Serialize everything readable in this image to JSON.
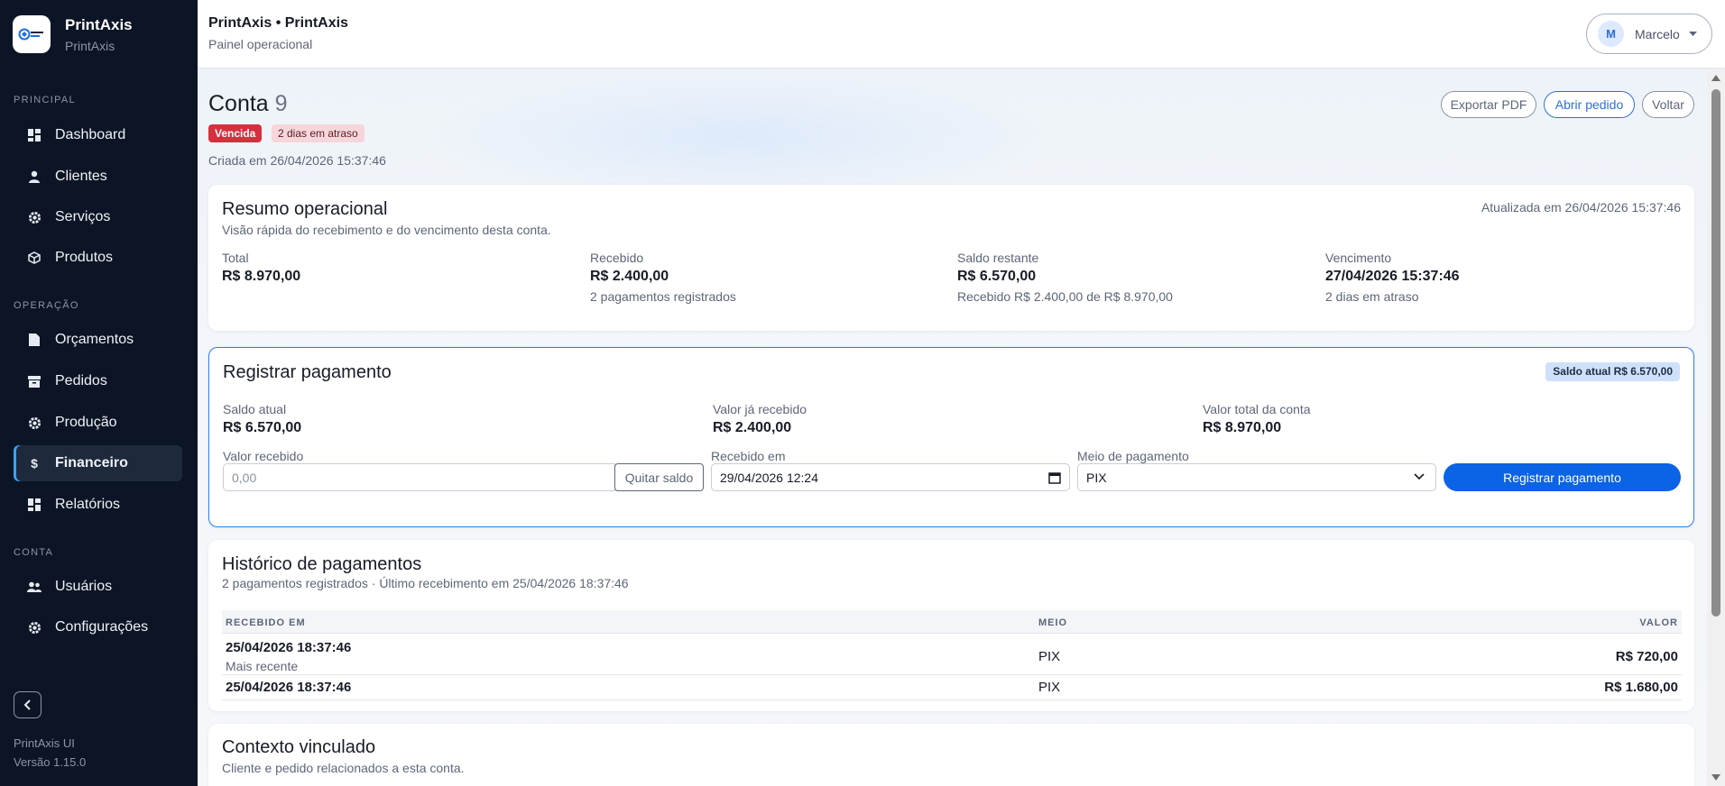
{
  "brand": {
    "name": "PrintAxis",
    "sub": "PrintAxis"
  },
  "sidebar": {
    "sections": [
      "PRINCIPAL",
      "OPERAÇÃO",
      "CONTA"
    ],
    "items": [
      {
        "label": "Dashboard",
        "icon": "dashboard-icon"
      },
      {
        "label": "Clientes",
        "icon": "user-icon"
      },
      {
        "label": "Serviços",
        "icon": "gear-icon"
      },
      {
        "label": "Produtos",
        "icon": "box-icon"
      },
      {
        "label": "Orçamentos",
        "icon": "document-icon"
      },
      {
        "label": "Pedidos",
        "icon": "archive-icon"
      },
      {
        "label": "Produção",
        "icon": "cog-icon"
      },
      {
        "label": "Financeiro",
        "icon": "dollar-icon",
        "active": true
      },
      {
        "label": "Relatórios",
        "icon": "grid-icon"
      },
      {
        "label": "Usuários",
        "icon": "users-icon"
      },
      {
        "label": "Configurações",
        "icon": "settings-icon"
      }
    ],
    "footer_name": "PrintAxis UI",
    "footer_version": "Versão 1.15.0"
  },
  "topbar": {
    "title": "PrintAxis • PrintAxis",
    "subtitle": "Painel operacional",
    "user_initial": "M",
    "user_name": "Marcelo"
  },
  "page": {
    "title": "Conta",
    "number": "9",
    "status_badge": "Vencida",
    "overdue_badge": "2 dias em atraso",
    "created": "Criada em 26/04/2026 15:37:46",
    "actions": {
      "export_pdf": "Exportar PDF",
      "open_order": "Abrir pedido",
      "back": "Voltar"
    }
  },
  "summary": {
    "title": "Resumo operacional",
    "subtitle": "Visão rápida do recebimento e do vencimento desta conta.",
    "updated": "Atualizada em 26/04/2026 15:37:46",
    "total_label": "Total",
    "total_value": "R$ 8.970,00",
    "received_label": "Recebido",
    "received_value": "R$ 2.400,00",
    "received_sub": "2 pagamentos registrados",
    "balance_label": "Saldo restante",
    "balance_value": "R$ 6.570,00",
    "balance_sub": "Recebido R$ 2.400,00 de R$ 8.970,00",
    "due_label": "Vencimento",
    "due_value": "27/04/2026 15:37:46",
    "due_sub": "2 dias em atraso"
  },
  "payment": {
    "title": "Registrar pagamento",
    "badge": "Saldo atual R$ 6.570,00",
    "current_label": "Saldo atual",
    "current_value": "R$ 6.570,00",
    "received_label": "Valor já recebido",
    "received_value": "R$ 2.400,00",
    "total_label": "Valor total da conta",
    "total_value": "R$ 8.970,00",
    "amount_label": "Valor recebido",
    "amount_placeholder": "0,00",
    "settle_button": "Quitar saldo",
    "date_label": "Recebido em",
    "date_value": "29/04/2026 12:24",
    "method_label": "Meio de pagamento",
    "method_value": "PIX",
    "submit_button": "Registrar pagamento"
  },
  "history": {
    "title": "Histórico de pagamentos",
    "subtitle": "2 pagamentos registrados · Último recebimento em 25/04/2026 18:37:46",
    "columns": [
      "RECEBIDO EM",
      "MEIO",
      "VALOR"
    ],
    "rows": [
      {
        "date": "25/04/2026 18:37:46",
        "note": "Mais recente",
        "method": "PIX",
        "value": "R$ 720,00"
      },
      {
        "date": "25/04/2026 18:37:46",
        "note": "",
        "method": "PIX",
        "value": "R$ 1.680,00"
      }
    ]
  },
  "context": {
    "title": "Contexto vinculado",
    "subtitle": "Cliente e pedido relacionados a esta conta."
  },
  "colors": {
    "sidebar_bg": "#0c1525",
    "accent": "#0b63e5",
    "danger": "#d6303f"
  }
}
